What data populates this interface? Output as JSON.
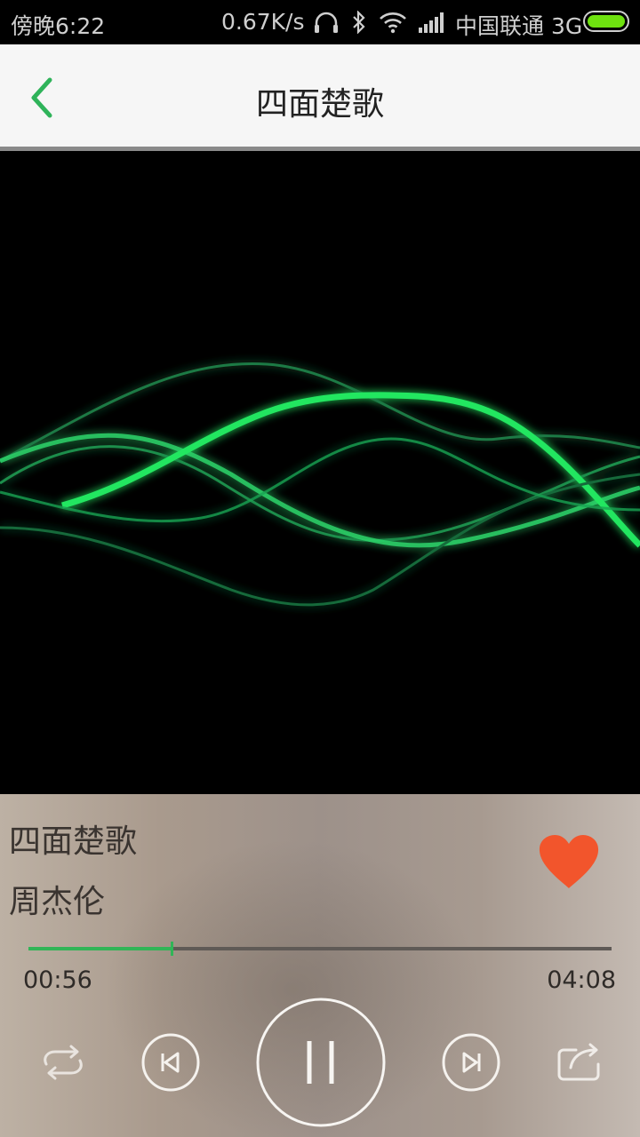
{
  "status_bar": {
    "time": "傍晚6:22",
    "speed": "0.67K/s",
    "carrier": "中国联通 3G",
    "battery_level": 1.0
  },
  "header": {
    "title": "四面楚歌"
  },
  "player": {
    "song_title": "四面楚歌",
    "artist": "周杰伦",
    "current_time": "00:56",
    "total_time": "04:08",
    "progress": 0.245,
    "favorited": true
  },
  "controls": {
    "repeat_icon": "repeat-icon",
    "prev_icon": "skip-previous-icon",
    "pause_icon": "pause-icon",
    "next_icon": "skip-next-icon",
    "share_icon": "share-icon"
  },
  "colors": {
    "accent": "#2fb35a",
    "heart": "#f2552c",
    "battery": "#6ee20f",
    "wave": "#1fe05a"
  }
}
